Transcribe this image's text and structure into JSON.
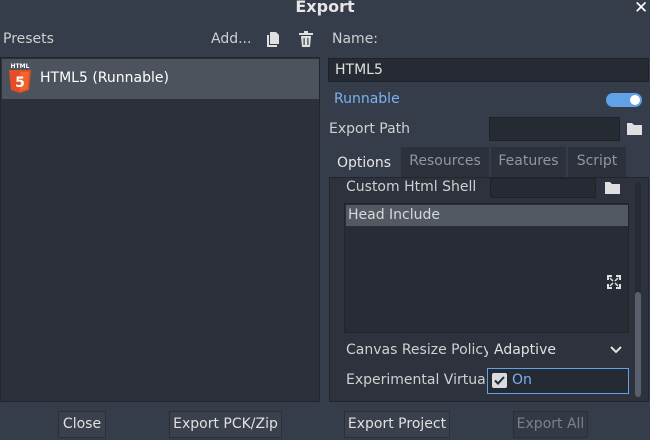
{
  "window": {
    "title": "Export",
    "close_glyph": "✕"
  },
  "presets_panel": {
    "label": "Presets",
    "add_label": "Add...",
    "duplicate_icon": "duplicate-icon",
    "delete_icon": "trash-icon",
    "items": [
      {
        "name": "HTML5 (Runnable)",
        "icon": "html5-icon",
        "selected": true
      }
    ]
  },
  "preset_details": {
    "name_label": "Name:",
    "name_value": "HTML5",
    "runnable_label": "Runnable",
    "runnable_on": true,
    "export_path_label": "Export Path",
    "export_path_value": ""
  },
  "tabs": [
    {
      "label": "Options",
      "active": true
    },
    {
      "label": "Resources",
      "active": false
    },
    {
      "label": "Features",
      "active": false
    },
    {
      "label": "Script",
      "active": false
    }
  ],
  "options": {
    "custom_html_shell_label": "Custom Html Shell",
    "head_include_label": "Head Include",
    "canvas_resize_policy_label": "Canvas Resize Policy",
    "canvas_resize_policy_value": "Adaptive",
    "experimental_virtual_label": "Experimental Virtual",
    "experimental_virtual_value": "On",
    "experimental_virtual_checked": true
  },
  "buttons": {
    "close": "Close",
    "export_pck_zip": "Export PCK/Zip",
    "export_project": "Export Project",
    "export_all": "Export All"
  },
  "colors": {
    "accent": "#5fa2e8",
    "background": "#363d4a",
    "selected": "#4d535d"
  }
}
